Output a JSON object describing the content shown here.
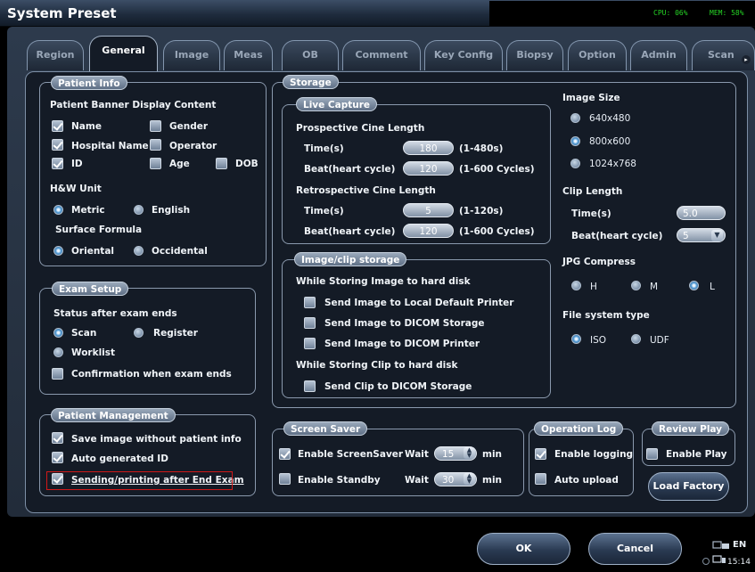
{
  "window": {
    "title": "System Preset",
    "cpu": "CPU: 06%",
    "mem": "MEM: 58%"
  },
  "tabs": [
    "Region",
    "General",
    "Image",
    "Meas",
    "OB",
    "Comment",
    "Key Config",
    "Biopsy",
    "Option",
    "Admin",
    "Scan Code"
  ],
  "patient_info": {
    "legend": "Patient Info",
    "banner_label": "Patient Banner Display Content",
    "name": "Name",
    "gender": "Gender",
    "hospital": "Hospital Name",
    "operator": "Operator",
    "id": "ID",
    "age": "Age",
    "dob": "DOB",
    "hw_label": "H&W Unit",
    "metric": "Metric",
    "english": "English",
    "surface_label": "Surface Formula",
    "oriental": "Oriental",
    "occidental": "Occidental"
  },
  "exam_setup": {
    "legend": "Exam Setup",
    "status_label": "Status after exam ends",
    "scan": "Scan",
    "register": "Register",
    "worklist": "Worklist",
    "confirmation": "Confirmation when exam ends"
  },
  "patient_mgmt": {
    "legend": "Patient Management",
    "save_without": "Save image without patient info",
    "auto_id": "Auto generated ID",
    "sending": "Sending/printing after End Exam"
  },
  "storage": {
    "legend": "Storage",
    "live_capture": {
      "legend": "Live Capture",
      "prospective": "Prospective Cine Length",
      "retrospective": "Retrospective Cine Length",
      "time_label": "Time(s)",
      "beat_label": "Beat(heart cycle)",
      "pro_time": "180",
      "pro_time_range": "(1-480s)",
      "pro_beat": "120",
      "pro_beat_range": "(1-600 Cycles)",
      "retro_time": "5",
      "retro_time_range": "(1-120s)",
      "retro_beat": "120",
      "retro_beat_range": "(1-600 Cycles)"
    },
    "image_clip": {
      "legend": "Image/clip storage",
      "while_image": "While Storing Image to hard disk",
      "local_printer": "Send Image to Local Default Printer",
      "dicom_storage": "Send Image to DICOM Storage",
      "dicom_printer": "Send Image to DICOM Printer",
      "while_clip": "While Storing Clip to hard disk",
      "clip_dicom": "Send Clip to DICOM Storage"
    },
    "image_size": {
      "label": "Image Size",
      "s1": "640x480",
      "s2": "800x600",
      "s3": "1024x768"
    },
    "clip_length": {
      "label": "Clip Length",
      "time_label": "Time(s)",
      "time_value": "5.0",
      "beat_label": "Beat(heart cycle)",
      "beat_value": "5"
    },
    "jpg": {
      "label": "JPG Compress",
      "h": "H",
      "m": "M",
      "l": "L"
    },
    "fs": {
      "label": "File system type",
      "iso": "ISO",
      "udf": "UDF"
    }
  },
  "screen_saver": {
    "legend": "Screen Saver",
    "enable_saver": "Enable ScreenSaver",
    "enable_standby": "Enable Standby",
    "wait": "Wait",
    "min": "min",
    "saver_wait": "15",
    "standby_wait": "30"
  },
  "operation_log": {
    "legend": "Operation Log",
    "enable_logging": "Enable logging",
    "auto_upload": "Auto upload"
  },
  "review_play": {
    "legend": "Review Play",
    "enable_play": "Enable Play"
  },
  "buttons": {
    "load_factory": "Load Factory",
    "ok": "OK",
    "cancel": "Cancel"
  },
  "statusbar": {
    "time": "15:14",
    "ime": "EN"
  }
}
